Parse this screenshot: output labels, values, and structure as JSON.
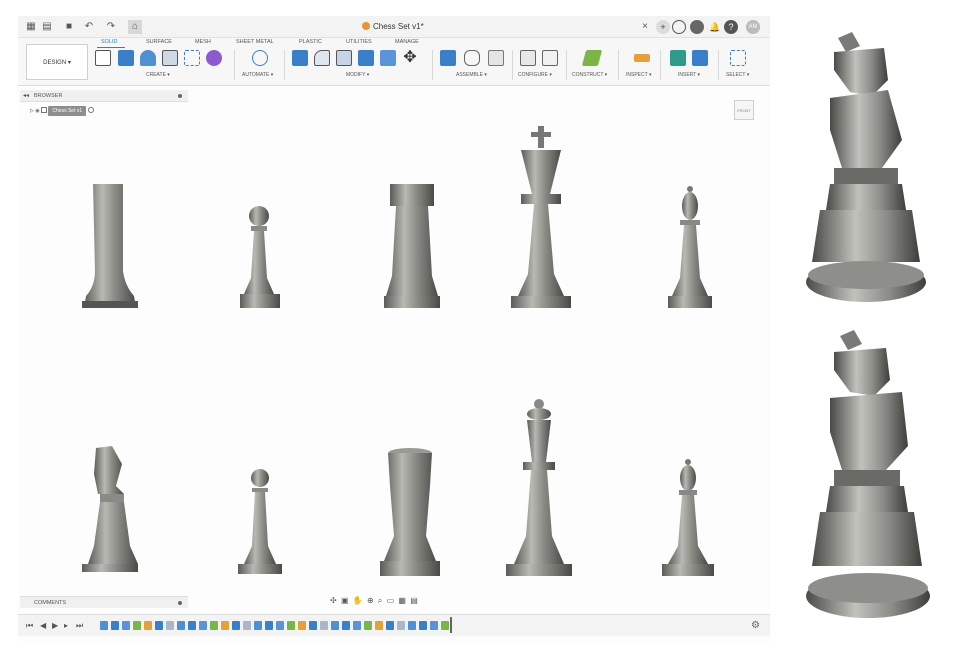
{
  "title_bar": {
    "document_title": "Chess Set v1*",
    "icons": [
      "grid-icon",
      "file-icon",
      "save-icon",
      "undo-icon",
      "redo-icon",
      "home-icon"
    ],
    "right_icons": [
      "close-icon",
      "new-tab-icon",
      "sync-icon",
      "job-status-icon",
      "notifications-icon",
      "help-icon"
    ],
    "user_initials": "AM"
  },
  "ribbon": {
    "workspace_button": "DESIGN ▾",
    "tabs": [
      "SOLID",
      "SURFACE",
      "MESH",
      "SHEET METAL",
      "PLASTIC",
      "UTILITIES",
      "MANAGE"
    ],
    "active_tab": "SOLID",
    "groups": [
      "CREATE ▾",
      "AUTOMATE ▾",
      "MODIFY ▾",
      "ASSEMBLE ▾",
      "CONFIGURE ▾",
      "CONSTRUCT ▾",
      "INSPECT ▾",
      "INSERT ▾",
      "SELECT ▾"
    ]
  },
  "browser": {
    "header": "BROWSER",
    "root_item": "Chess Set v1"
  },
  "comments": {
    "header": "COMMENTS"
  },
  "viewcube": {
    "face_label": "FRONT"
  },
  "colors": {
    "accent": "#2a7fd4",
    "piece_metal": "#8a8a85"
  },
  "scene": {
    "top_row_pieces": [
      "rook-profile",
      "pawn",
      "rook",
      "king",
      "bishop"
    ],
    "bottom_row_pieces": [
      "knight",
      "pawn",
      "rook",
      "king",
      "bishop"
    ],
    "side_views": [
      "knight-closeup-top",
      "knight-closeup-bottom"
    ]
  }
}
